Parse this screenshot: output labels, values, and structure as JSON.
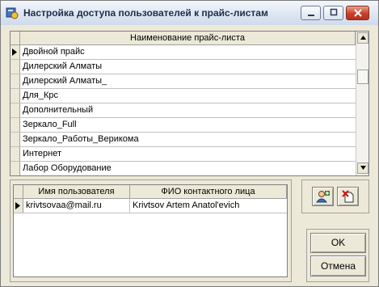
{
  "window": {
    "title": "Настройка доступа пользователей к прайс-листам"
  },
  "price_grid": {
    "column_header": "Наименование прайс-листа",
    "rows": [
      "Двойной прайс",
      "Дилерский Алматы",
      "Дилерский Алматы_",
      "Для_Крс",
      "Дополнительный",
      "Зеркало_Full",
      "Зеркало_Работы_Верикома",
      "Интернет",
      "Лабор Оборудование"
    ],
    "selected_row": 0
  },
  "users_grid": {
    "headers": {
      "username": "Имя пользователя",
      "contact_name": "ФИО контактного лица"
    },
    "rows": [
      {
        "username": "krivtsovaa@mail.ru",
        "contact_name": "Krivtsov Artem Anatol'evich"
      }
    ]
  },
  "toolbar": {
    "add_user_icon": "add-user-icon",
    "remove_user_icon": "remove-user-icon"
  },
  "buttons": {
    "ok_label": "OK",
    "cancel_label": "Отмена"
  }
}
